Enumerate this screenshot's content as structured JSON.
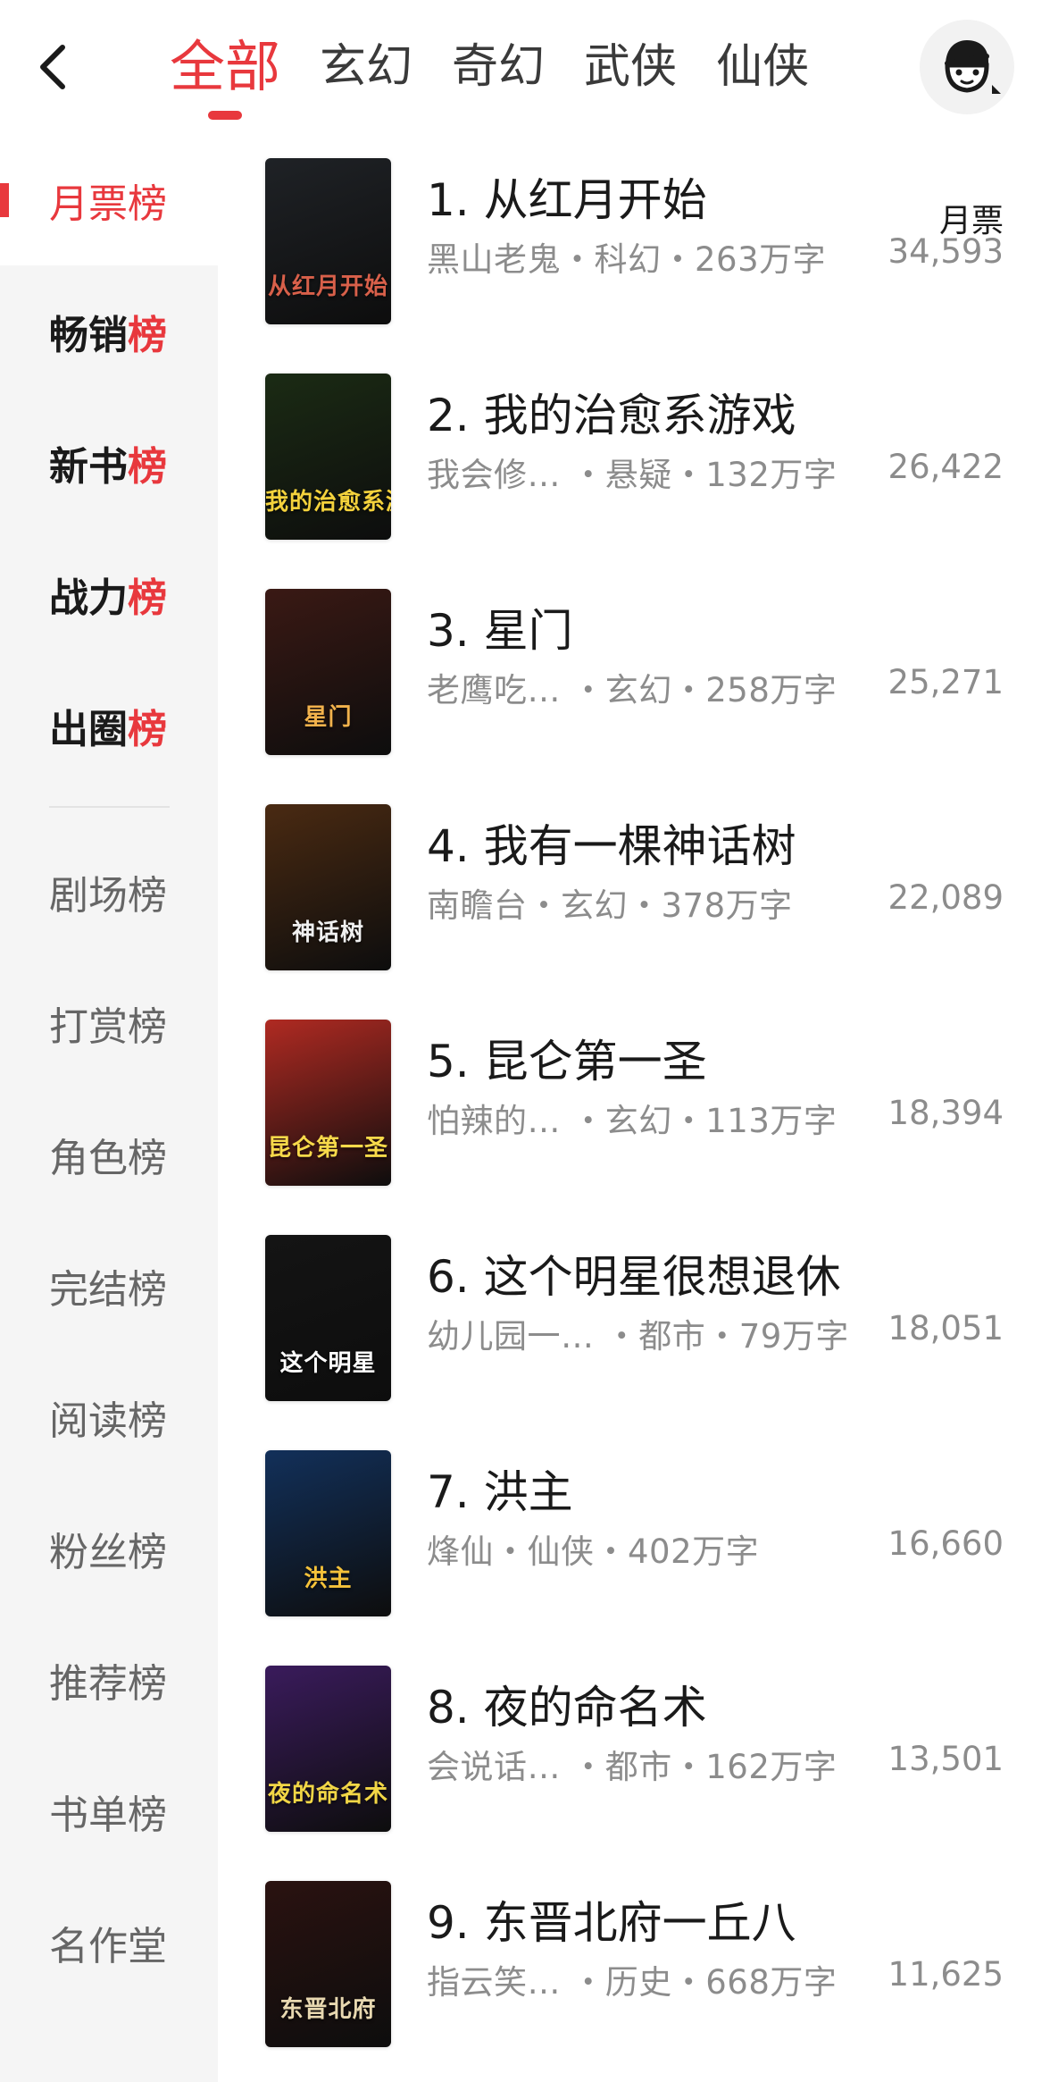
{
  "header": {
    "tabs": [
      {
        "label": "全部",
        "active": true
      },
      {
        "label": "玄幻"
      },
      {
        "label": "奇幻"
      },
      {
        "label": "武侠"
      },
      {
        "label": "仙侠"
      }
    ],
    "back_icon": "chevron-left-icon",
    "avatar_icon": "user-avatar-icon"
  },
  "sidebar": {
    "primary": [
      {
        "head": "月票",
        "last": "榜"
      },
      {
        "head": "畅销",
        "last": "榜"
      },
      {
        "head": "新书",
        "last": "榜"
      },
      {
        "head": "战力",
        "last": "榜"
      },
      {
        "head": "出圈",
        "last": "榜"
      }
    ],
    "secondary": [
      "剧场榜",
      "打赏榜",
      "角色榜",
      "完结榜",
      "阅读榜",
      "粉丝榜",
      "推荐榜",
      "书单榜",
      "名作堂"
    ]
  },
  "list": {
    "vote_label": "月票",
    "books": [
      {
        "rank": "1.",
        "title": "从红月开始",
        "meta": "黑山老鬼・科幻・263万字",
        "votes": "34,593",
        "cover_text": "从红月开始",
        "cover_bg": "#1f2226",
        "cover_fg": "#d8604a"
      },
      {
        "rank": "2.",
        "title": "我的治愈系游戏",
        "meta": "我会修…  ・悬疑・132万字",
        "votes": "26,422",
        "cover_text": "我的治愈系游戏",
        "cover_bg": "#1b2b14",
        "cover_fg": "#f4d23c"
      },
      {
        "rank": "3.",
        "title": "星门",
        "meta": "老鹰吃…  ・玄幻・258万字",
        "votes": "25,271",
        "cover_text": "星门",
        "cover_bg": "#3a1914",
        "cover_fg": "#f2b24c"
      },
      {
        "rank": "4.",
        "title": "我有一棵神话树",
        "meta": "南瞻台・玄幻・378万字",
        "votes": "22,089",
        "cover_text": "神话树",
        "cover_bg": "#4a2a12",
        "cover_fg": "#f0f0f0"
      },
      {
        "rank": "5.",
        "title": "昆仑第一圣",
        "meta": "怕辣的…  ・玄幻・113万字",
        "votes": "18,394",
        "cover_text": "昆仑第一圣",
        "cover_bg": "#b02a22",
        "cover_fg": "#f7d94a"
      },
      {
        "rank": "6.",
        "title": "这个明星很想退休",
        "meta": "幼儿园一…  ・都市・79万字",
        "votes": "18,051",
        "cover_text": "这个明星",
        "cover_bg": "#141414",
        "cover_fg": "#ffffff"
      },
      {
        "rank": "7.",
        "title": "洪主",
        "meta": "烽仙・仙侠・402万字",
        "votes": "16,660",
        "cover_text": "洪主",
        "cover_bg": "#12305a",
        "cover_fg": "#f5c23a"
      },
      {
        "rank": "8.",
        "title": "夜的命名术",
        "meta": "会说话…  ・都市・162万字",
        "votes": "13,501",
        "cover_text": "夜的命名术",
        "cover_bg": "#3a1b5c",
        "cover_fg": "#f2d646"
      },
      {
        "rank": "9.",
        "title": "东晋北府一丘八",
        "meta": "指云笑…  ・历史・668万字",
        "votes": "11,625",
        "cover_text": "东晋北府",
        "cover_bg": "#2a1210",
        "cover_fg": "#e8d8b0"
      }
    ]
  }
}
